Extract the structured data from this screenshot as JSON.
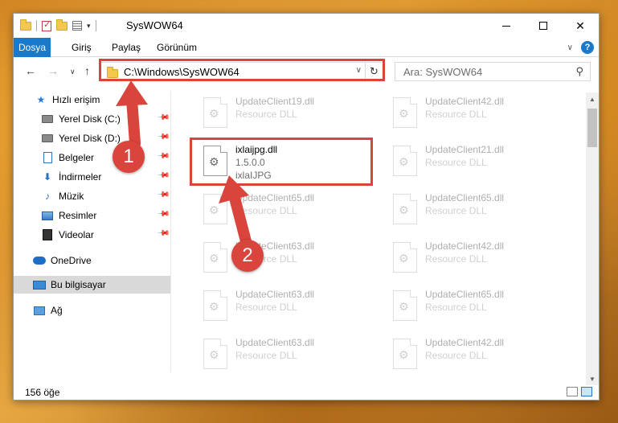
{
  "window": {
    "title": "SysWOW64"
  },
  "ribbon": {
    "tabs": [
      "Dosya",
      "Giriş",
      "Paylaş",
      "Görünüm"
    ]
  },
  "address": {
    "path": "C:\\Windows\\SysWOW64"
  },
  "search": {
    "placeholder": "Ara: SysWOW64"
  },
  "sidebar": {
    "items": [
      {
        "label": "Hızlı erişim",
        "icon": "star-icon"
      },
      {
        "label": "Yerel Disk (C:)",
        "icon": "drive-icon"
      },
      {
        "label": "Yerel Disk (D:)",
        "icon": "drive-icon"
      },
      {
        "label": "Belgeler",
        "icon": "documents-icon"
      },
      {
        "label": "İndirmeler",
        "icon": "downloads-icon"
      },
      {
        "label": "Müzik",
        "icon": "music-icon"
      },
      {
        "label": "Resimler",
        "icon": "pictures-icon"
      },
      {
        "label": "Videolar",
        "icon": "videos-icon"
      },
      {
        "label": "OneDrive",
        "icon": "cloud-icon"
      },
      {
        "label": "Bu bilgisayar",
        "icon": "computer-icon"
      },
      {
        "label": "Ağ",
        "icon": "network-icon"
      }
    ],
    "selected": "Bu bilgisayar"
  },
  "files": {
    "highlighted": {
      "name": "ixlaijpg.dll",
      "version": "1.5.0.0",
      "description": "ixlaIJPG"
    },
    "left": [
      {
        "name": "UpdateClient19.dll",
        "type": "Resource DLL"
      },
      {
        "name": "UpdateClient65.dll",
        "type": "Resource DLL"
      },
      {
        "name": "UpdateClient63.dll",
        "type": "Resource DLL"
      },
      {
        "name": "UpdateClient63.dll",
        "type": "Resource DLL"
      },
      {
        "name": "UpdateClient63.dll",
        "type": "Resource DLL"
      }
    ],
    "right": [
      {
        "name": "UpdateClient42.dll",
        "type": "Resource DLL"
      },
      {
        "name": "UpdateClient21.dll",
        "type": "Resource DLL"
      },
      {
        "name": "UpdateClient65.dll",
        "type": "Resource DLL"
      },
      {
        "name": "UpdateClient42.dll",
        "type": "Resource DLL"
      },
      {
        "name": "UpdateClient65.dll",
        "type": "Resource DLL"
      },
      {
        "name": "UpdateClient42.dll",
        "type": "Resource DLL"
      }
    ]
  },
  "status": {
    "count": "156 öğe"
  },
  "callouts": {
    "first": "1",
    "second": "2"
  },
  "colors": {
    "accent": "#1979ca",
    "callout": "#d9443d",
    "selected_bg": "#d9d9d9"
  }
}
